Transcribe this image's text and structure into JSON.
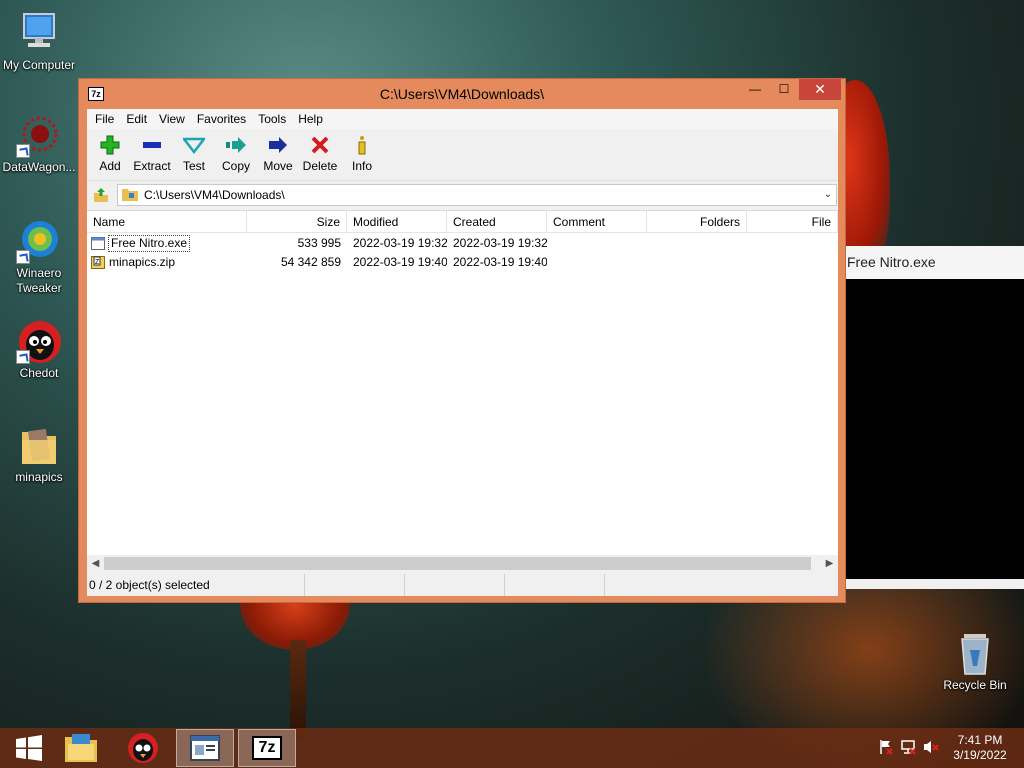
{
  "desktop": {
    "icons": [
      {
        "label": "My Computer"
      },
      {
        "label": "DataWagon..."
      },
      {
        "label": "Winaero Tweaker"
      },
      {
        "label": "Chedot"
      },
      {
        "label": "minapics"
      },
      {
        "label": "Recycle Bin"
      }
    ]
  },
  "window": {
    "app_icon": "7z",
    "title": "C:\\Users\\VM4\\Downloads\\",
    "minimize": "—",
    "maximize": "☐",
    "close": "✕",
    "menu": [
      "File",
      "Edit",
      "View",
      "Favorites",
      "Tools",
      "Help"
    ],
    "toolbar": [
      {
        "label": "Add",
        "icon": "add-icon"
      },
      {
        "label": "Extract",
        "icon": "extract-icon"
      },
      {
        "label": "Test",
        "icon": "test-icon"
      },
      {
        "label": "Copy",
        "icon": "copy-icon"
      },
      {
        "label": "Move",
        "icon": "move-icon"
      },
      {
        "label": "Delete",
        "icon": "delete-icon"
      },
      {
        "label": "Info",
        "icon": "info-icon"
      }
    ],
    "address": "C:\\Users\\VM4\\Downloads\\",
    "columns": [
      "Name",
      "Size",
      "Modified",
      "Created",
      "Comment",
      "Folders",
      "File"
    ],
    "rows": [
      {
        "name": "Free Nitro.exe",
        "size": "533 995",
        "modified": "2022-03-19 19:32",
        "created": "2022-03-19 19:32",
        "icon": "exe-file-icon"
      },
      {
        "name": "minapics.zip",
        "size": "54 342 859",
        "modified": "2022-03-19 19:40",
        "created": "2022-03-19 19:40",
        "icon": "zip-file-icon"
      }
    ],
    "status": "0 / 2 object(s) selected"
  },
  "preview": {
    "title": "Free Nitro.exe"
  },
  "taskbar": {
    "time": "7:41 PM",
    "date": "3/19/2022",
    "app_7z": "7z"
  },
  "colors": {
    "window_frame": "#e58a5c",
    "close_button": "#c7453a"
  }
}
